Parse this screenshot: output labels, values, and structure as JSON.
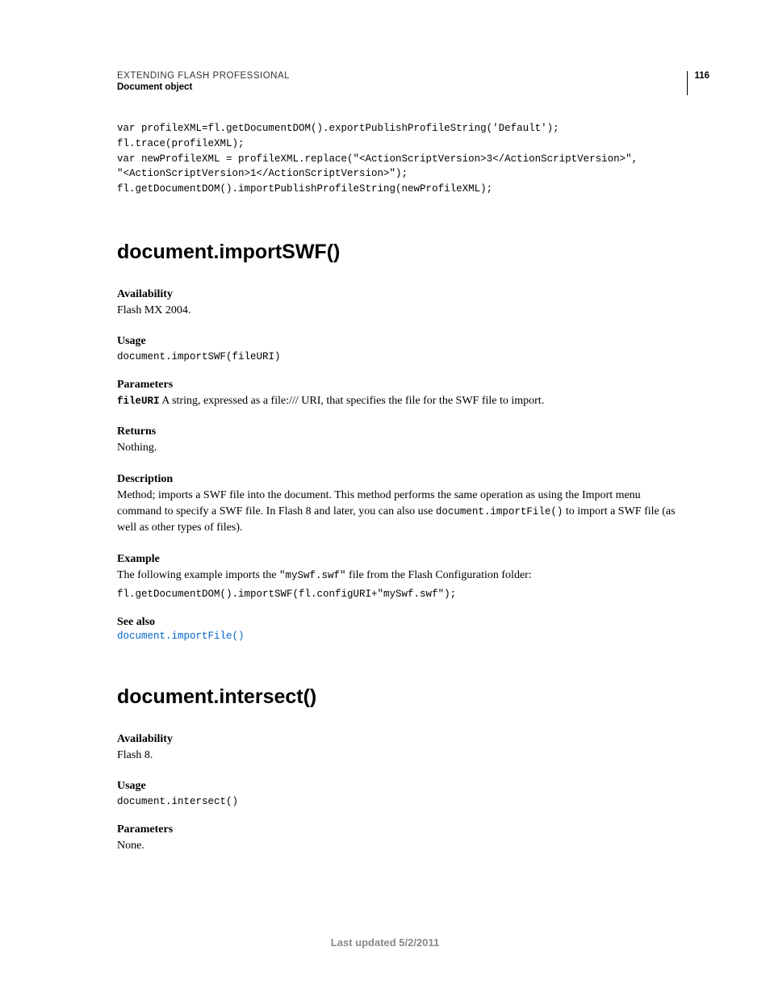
{
  "header": {
    "title": "EXTENDING FLASH PROFESSIONAL",
    "subtitle": "Document object",
    "pageNumber": "116"
  },
  "topCode": "var profileXML=fl.getDocumentDOM().exportPublishProfileString('Default');\nfl.trace(profileXML);\nvar newProfileXML = profileXML.replace(\"<ActionScriptVersion>3</ActionScriptVersion>\",\n\"<ActionScriptVersion>1</ActionScriptVersion>\");\nfl.getDocumentDOM().importPublishProfileString(newProfileXML);",
  "method1": {
    "title": "document.importSWF()",
    "availability": {
      "label": "Availability",
      "text": "Flash MX 2004."
    },
    "usage": {
      "label": "Usage",
      "code": "document.importSWF(fileURI)"
    },
    "parameters": {
      "label": "Parameters",
      "paramName": "fileURI",
      "paramDesc": "  A string, expressed as a file:/// URI, that specifies the file for the SWF file to import."
    },
    "returns": {
      "label": "Returns",
      "text": "Nothing."
    },
    "description": {
      "label": "Description",
      "textBefore": "Method; imports a SWF file into the document. This method performs the same operation as using the Import menu command to specify a SWF file. In Flash 8 and later, you can also use ",
      "inlineCode": "document.importFile()",
      "textAfter": " to import a SWF file (as well as other types of files)."
    },
    "example": {
      "label": "Example",
      "textBefore": "The following example imports the ",
      "inlineCode": "\"mySwf.swf\"",
      "textAfter": " file from the Flash Configuration folder:",
      "code": "fl.getDocumentDOM().importSWF(fl.configURI+\"mySwf.swf\");"
    },
    "seeAlso": {
      "label": "See also",
      "link": "document.importFile()"
    }
  },
  "method2": {
    "title": "document.intersect()",
    "availability": {
      "label": "Availability",
      "text": "Flash 8."
    },
    "usage": {
      "label": "Usage",
      "code": "document.intersect()"
    },
    "parameters": {
      "label": "Parameters",
      "text": "None."
    }
  },
  "footer": "Last updated 5/2/2011"
}
